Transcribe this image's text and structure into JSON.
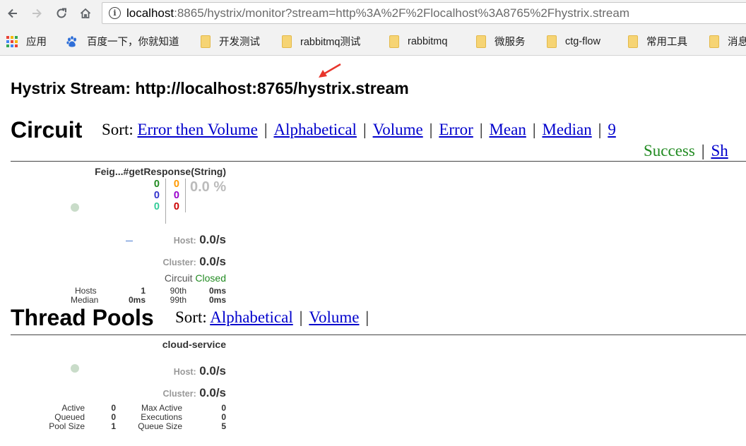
{
  "browser": {
    "url_host": "localhost",
    "url_rest": ":8865/hystrix/monitor?stream=http%3A%2F%2Flocalhost%3A8765%2Fhystrix.stream",
    "bookmarks": [
      {
        "label": "应用",
        "icon": "apps-grid-icon"
      },
      {
        "label": "百度一下，你就知道",
        "icon": "baidu-paw-icon"
      },
      {
        "label": "开发测试",
        "icon": "folder-icon"
      },
      {
        "label": "rabbitmq测试",
        "icon": "folder-icon"
      },
      {
        "label": "rabbitmq",
        "icon": "folder-icon"
      },
      {
        "label": "微服务",
        "icon": "folder-icon"
      },
      {
        "label": "ctg-flow",
        "icon": "folder-icon"
      },
      {
        "label": "常用工具",
        "icon": "folder-icon"
      },
      {
        "label": "消息",
        "icon": "folder-icon"
      }
    ]
  },
  "page": {
    "stream_title": "Hystrix Stream: http://localhost:8765/hystrix.stream",
    "annotation_color": "#e8352c"
  },
  "circuit": {
    "title": "Circuit",
    "sort_label": "Sort:",
    "sort_links": [
      "Error then Volume",
      "Alphabetical",
      "Volume",
      "Error",
      "Mean",
      "Median",
      "9"
    ],
    "sort_links_row2": [
      "Success",
      "Sh"
    ],
    "monitor": {
      "name": "Feig...#getResponse(String)",
      "counts": {
        "success": "0",
        "short_circuited": "0",
        "bad_request": "0",
        "timeout": "0",
        "rejected": "0",
        "failure": "0"
      },
      "count_colors": {
        "success": "#228b22",
        "short_circuited": "#3333cc",
        "bad_request": "#33cc99",
        "timeout": "#ff9900",
        "rejected": "#9900cc",
        "failure": "#cc0000"
      },
      "error_rate": "0.0 %",
      "host_label": "Host:",
      "host_rate": "0.0/s",
      "cluster_label": "Cluster:",
      "cluster_rate": "0.0/s",
      "circuit_label": "Circuit",
      "circuit_state": "Closed",
      "stats": {
        "hosts_label": "Hosts",
        "hosts_value": "1",
        "p90_label": "90th",
        "p90_value": "0ms",
        "median_label": "Median",
        "median_value": "0ms",
        "p99_label": "99th",
        "p99_value": "0ms"
      }
    }
  },
  "thread_pools": {
    "title": "Thread Pools",
    "sort_label": "Sort:",
    "sort_links": [
      "Alphabetical",
      "Volume"
    ],
    "monitor": {
      "name": "cloud-service",
      "host_label": "Host:",
      "host_rate": "0.0/s",
      "cluster_label": "Cluster:",
      "cluster_rate": "0.0/s",
      "stats": {
        "active_label": "Active",
        "active_value": "0",
        "queued_label": "Queued",
        "queued_value": "0",
        "pool_size_label": "Pool Size",
        "pool_size_value": "1",
        "max_active_label": "Max Active",
        "max_active_value": "0",
        "executions_label": "Executions",
        "executions_value": "0",
        "queue_size_label": "Queue Size",
        "queue_size_value": "5"
      }
    }
  }
}
